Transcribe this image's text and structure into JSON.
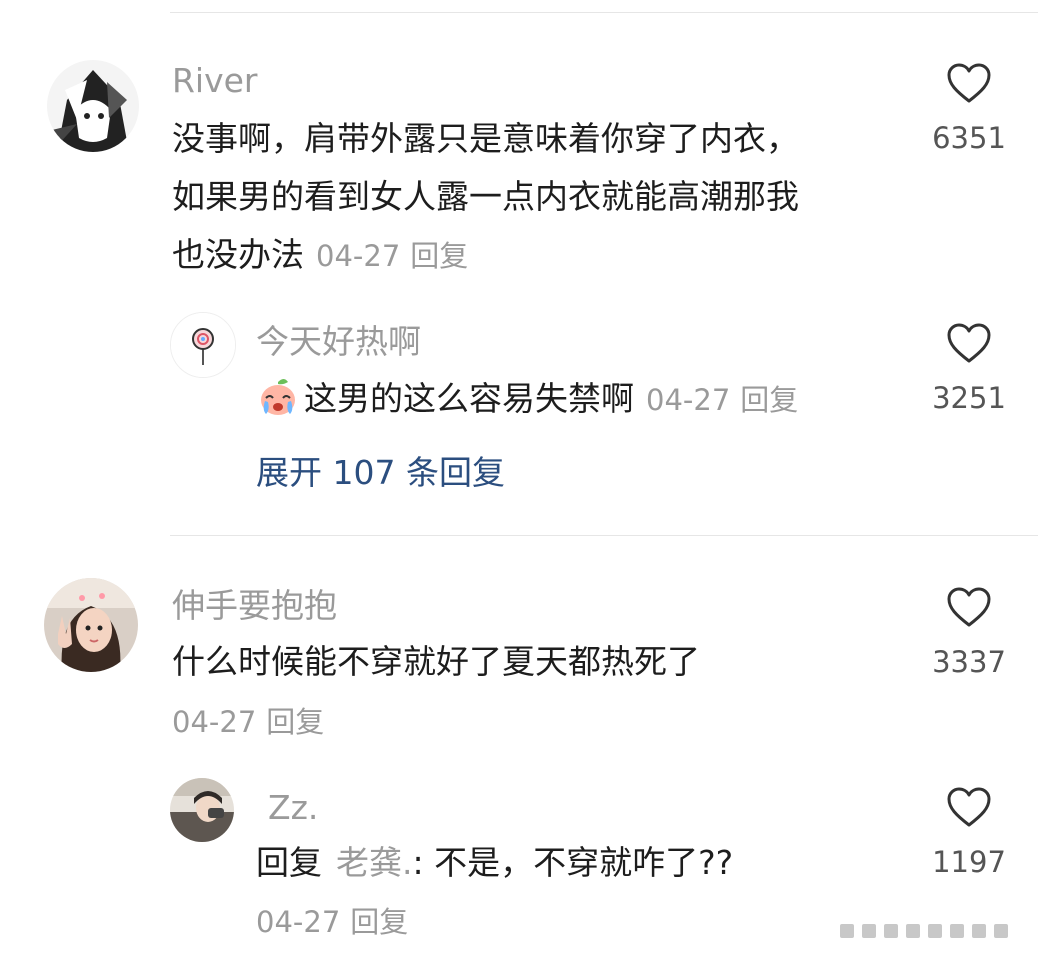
{
  "comments": [
    {
      "username": "River",
      "text_lines": [
        "没事啊，肩带外露只是意味着你穿了内衣，",
        "如果男的看到女人露一点内衣就能高潮那我",
        "也没办法"
      ],
      "date": "04-27",
      "reply_label": "回复",
      "likes": "6351",
      "avatar_icon": "anime-avatar-icon",
      "sub_reply": {
        "username": "今天好热啊",
        "emoji_icon": "crying-peach-emoji-icon",
        "text": "这男的这么容易失禁啊",
        "date": "04-27",
        "reply_label": "回复",
        "likes": "3251",
        "avatar_icon": "lollipop-avatar-icon"
      },
      "expand_label": "展开 107 条回复"
    },
    {
      "username": "伸手要抱抱",
      "text": "什么时候能不穿就好了夏天都热死了",
      "date": "04-27",
      "reply_label": "回复",
      "likes": "3337",
      "avatar_icon": "girl-selfie-avatar-icon",
      "sub_reply": {
        "username": "Zz.",
        "reply_prefix": "回复",
        "mention": "老龚.",
        "text": ": 不是，不穿就咋了??",
        "date": "04-27",
        "reply_label": "回复",
        "likes": "1197",
        "avatar_icon": "car-selfie-avatar-icon"
      }
    }
  ],
  "colors": {
    "username": "#9a9a9a",
    "text": "#1d1d1d",
    "link": "#2b4e7f",
    "divider": "#e6e6e6"
  }
}
